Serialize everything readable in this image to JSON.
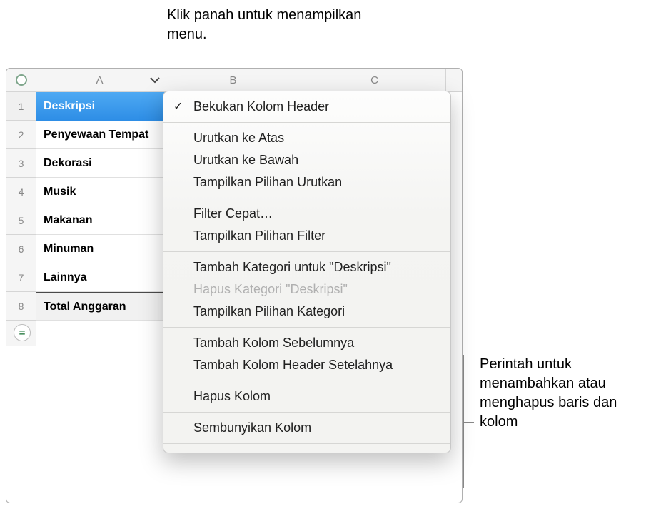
{
  "callouts": {
    "top": "Klik panah untuk menampilkan menu.",
    "right": "Perintah untuk menambahkan atau menghapus baris dan kolom"
  },
  "columns": [
    "A",
    "B",
    "C"
  ],
  "rows": [
    {
      "num": "1",
      "a": "Deskripsi",
      "type": "header"
    },
    {
      "num": "2",
      "a": "Penyewaan Tempat",
      "type": "body"
    },
    {
      "num": "3",
      "a": "Dekorasi",
      "type": "body"
    },
    {
      "num": "4",
      "a": "Musik",
      "type": "body"
    },
    {
      "num": "5",
      "a": "Makanan",
      "type": "body"
    },
    {
      "num": "6",
      "a": "Minuman",
      "type": "body"
    },
    {
      "num": "7",
      "a": "Lainnya",
      "type": "body"
    },
    {
      "num": "8",
      "a": "Total Anggaran",
      "type": "footer"
    }
  ],
  "menu": {
    "groups": [
      [
        {
          "label": "Bekukan Kolom Header",
          "checked": true,
          "enabled": true
        }
      ],
      [
        {
          "label": "Urutkan ke Atas",
          "checked": false,
          "enabled": true
        },
        {
          "label": "Urutkan ke Bawah",
          "checked": false,
          "enabled": true
        },
        {
          "label": "Tampilkan Pilihan Urutkan",
          "checked": false,
          "enabled": true
        }
      ],
      [
        {
          "label": "Filter Cepat…",
          "checked": false,
          "enabled": true
        },
        {
          "label": "Tampilkan Pilihan Filter",
          "checked": false,
          "enabled": true
        }
      ],
      [
        {
          "label": "Tambah Kategori untuk \"Deskripsi\"",
          "checked": false,
          "enabled": true
        },
        {
          "label": "Hapus Kategori \"Deskripsi\"",
          "checked": false,
          "enabled": false
        },
        {
          "label": "Tampilkan Pilihan Kategori",
          "checked": false,
          "enabled": true
        }
      ],
      [
        {
          "label": "Tambah Kolom Sebelumnya",
          "checked": false,
          "enabled": true
        },
        {
          "label": "Tambah Kolom Header Setelahnya",
          "checked": false,
          "enabled": true
        }
      ],
      [
        {
          "label": "Hapus Kolom",
          "checked": false,
          "enabled": true
        }
      ],
      [
        {
          "label": "Sembunyikan Kolom",
          "checked": false,
          "enabled": true
        }
      ]
    ]
  },
  "formula_symbol": "="
}
